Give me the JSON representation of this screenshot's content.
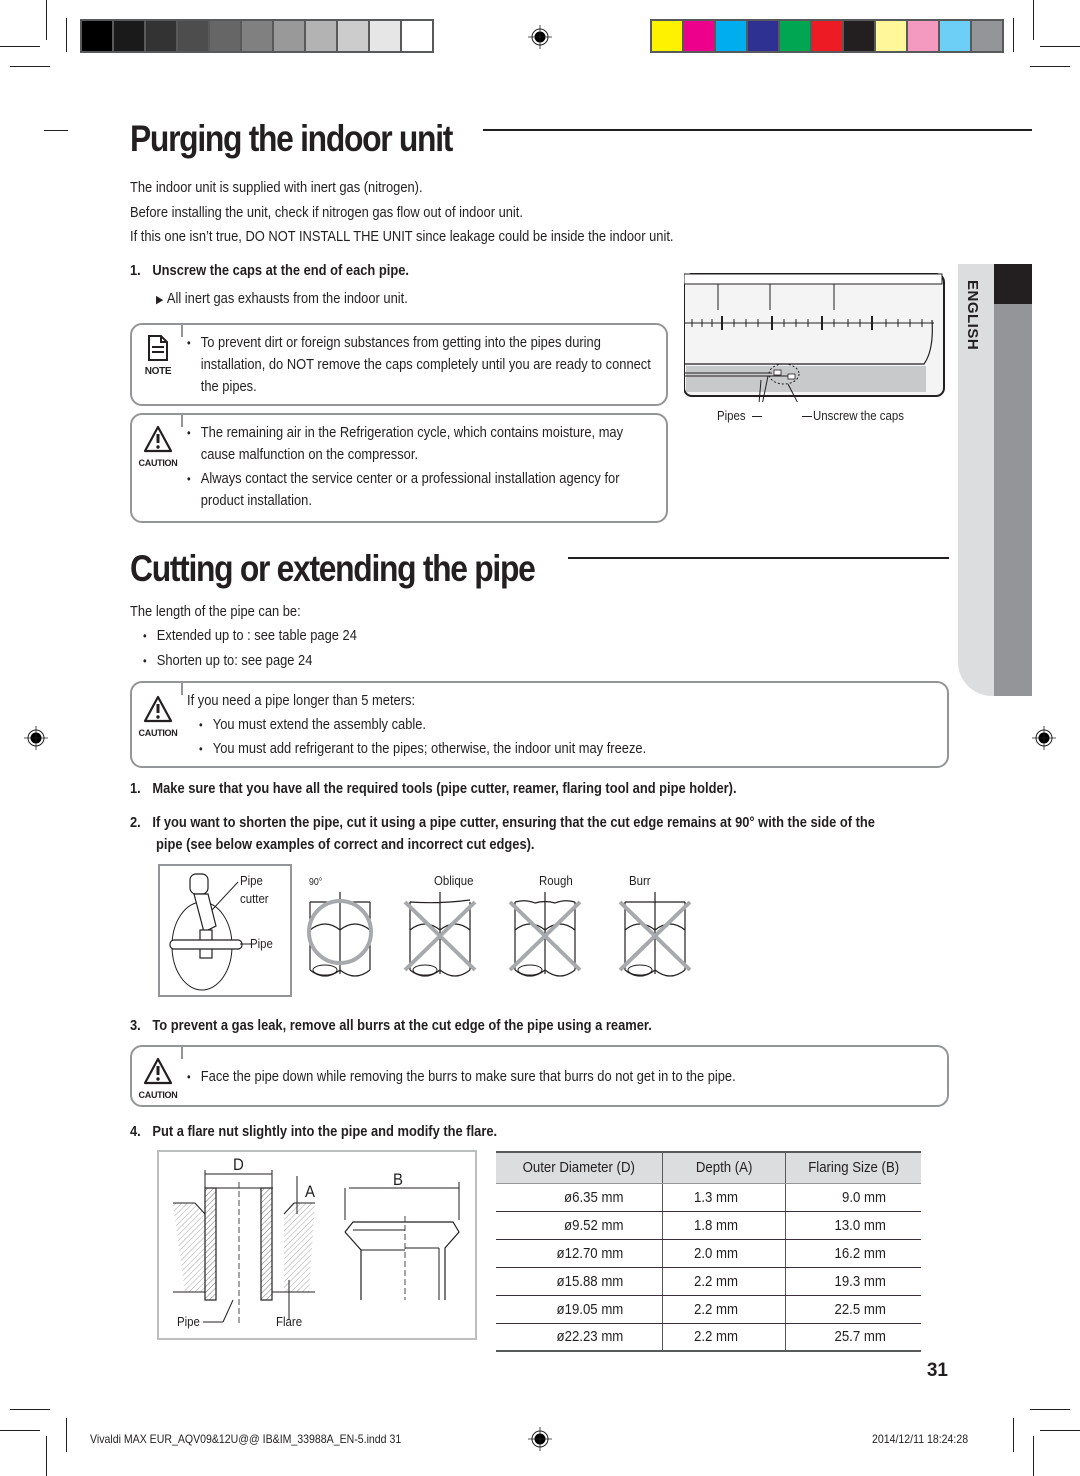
{
  "print_marks": {
    "grayscale_swatches": [
      "#000000",
      "#1a1a1a",
      "#333333",
      "#4d4d4d",
      "#666666",
      "#808080",
      "#999999",
      "#b3b3b3",
      "#cccccc",
      "#e6e6e6",
      "#ffffff"
    ],
    "color_swatches": [
      "#fff200",
      "#ec008c",
      "#00aeef",
      "#2e3192",
      "#00a651",
      "#ed1c24",
      "#231f20",
      "#fff799",
      "#f49ac1",
      "#6dcff6",
      "#939598"
    ]
  },
  "side_tab": {
    "language": "ENGLISH"
  },
  "section1": {
    "title": "Purging the indoor unit",
    "intro": [
      "The indoor unit is supplied with inert gas  (nitrogen).",
      "Before installing the unit, check if nitrogen gas flow out of indoor unit.",
      "If this one isn’t true, DO NOT INSTALL THE UNIT since leakage could be inside the indoor unit."
    ],
    "step1": {
      "num": "1.",
      "text": "Unscrew the caps at the end of each pipe."
    },
    "step1_result": "All inert gas exhausts from the indoor unit.",
    "note": {
      "label": "NOTE",
      "items": [
        "To prevent dirt or foreign substances from getting into the pipes during installation, do NOT remove the caps completely until you are ready to connect the pipes."
      ]
    },
    "caution": {
      "label": "CAUTION",
      "items": [
        "The remaining air in the Refrigeration cycle, which contains moisture, may cause malfunction on the compressor.",
        "Always contact the service center or a professional installation agency for product installation."
      ]
    },
    "figure": {
      "pipes_label": "Pipes",
      "caps_label": "Unscrew the caps"
    }
  },
  "section2": {
    "title": "Cutting or extending the pipe",
    "intro": "The length of the pipe can be:",
    "length_items": [
      "Extended up to : see table page 24",
      "Shorten up to: see page 24"
    ],
    "caution1": {
      "label": "CAUTION",
      "heading": "If you need a pipe longer than 5 meters:",
      "items": [
        "You must extend the assembly cable.",
        "You must add refrigerant to the pipes; otherwise, the indoor unit may freeze."
      ]
    },
    "steps": [
      {
        "num": "1.",
        "text": "Make sure that you have all the required tools (pipe cutter, reamer, flaring tool and pipe holder)."
      },
      {
        "num": "2.",
        "text": "If you want to shorten the pipe, cut it using a pipe cutter, ensuring that the cut edge remains at 90° with the side of the",
        "text2": "pipe (see below examples of correct and incorrect cut edges)."
      },
      {
        "num": "3.",
        "text": "To prevent a gas leak, remove all burrs at the cut edge of the pipe using a reamer."
      },
      {
        "num": "4.",
        "text": "Put a flare nut slightly into the pipe and modify the flare."
      }
    ],
    "cut_figure": {
      "pipe_cutter_label_1": "Pipe",
      "pipe_cutter_label_2": "cutter",
      "pipe_label": "Pipe",
      "angle_label": "90°",
      "examples": [
        {
          "label": "",
          "correct": true
        },
        {
          "label": "Oblique",
          "correct": false
        },
        {
          "label": "Rough",
          "correct": false
        },
        {
          "label": "Burr",
          "correct": false
        }
      ]
    },
    "caution2": {
      "label": "CAUTION",
      "items": [
        "Face the pipe down while removing the burrs to make sure that burrs do not get in to the pipe."
      ]
    },
    "flare_figure": {
      "d": "D",
      "a": "A",
      "b": "B",
      "pipe": "Pipe",
      "flare": "Flare"
    },
    "flare_table": {
      "headers": [
        "Outer Diameter (D)",
        "Depth (A)",
        "Flaring Size (B)"
      ],
      "rows": [
        [
          "ø6.35 mm",
          "1.3 mm",
          "9.0 mm"
        ],
        [
          "ø9.52 mm",
          "1.8 mm",
          "13.0 mm"
        ],
        [
          "ø12.70 mm",
          "2.0 mm",
          "16.2 mm"
        ],
        [
          "ø15.88 mm",
          "2.2 mm",
          "19.3 mm"
        ],
        [
          "ø19.05 mm",
          "2.2 mm",
          "22.5 mm"
        ],
        [
          "ø22.23 mm",
          "2.2 mm",
          "25.7 mm"
        ]
      ]
    }
  },
  "page_number": "31",
  "footer": {
    "file": "Vivaldi MAX EUR_AQV09&12U@@ IB&IM_33988A_EN-5.indd   31",
    "timestamp": "2014/12/11   18:24:28"
  }
}
